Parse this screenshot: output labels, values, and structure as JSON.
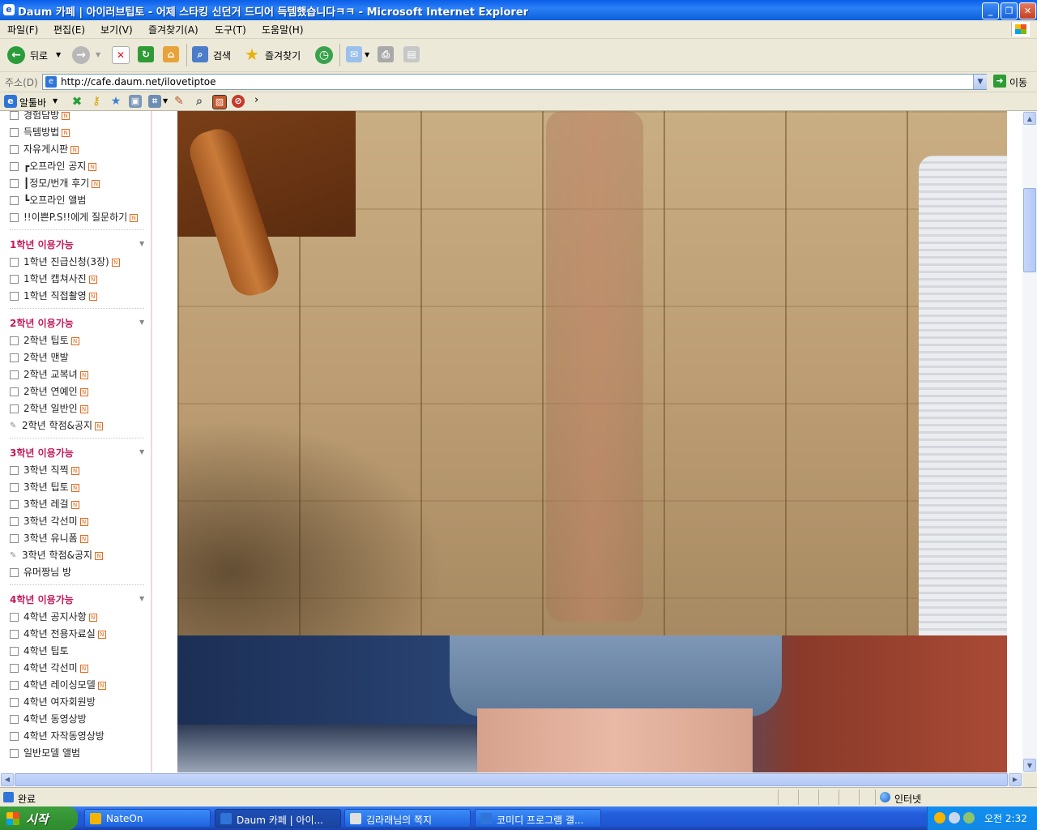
{
  "window": {
    "title": "Daum 카페 | 아이러브팁토 - 어제 스타킹 신던거 드디어 득템했습니다ㅋㅋ - Microsoft Internet Explorer"
  },
  "menu": [
    "파일(F)",
    "편집(E)",
    "보기(V)",
    "즐겨찾기(A)",
    "도구(T)",
    "도움말(H)"
  ],
  "toolbar": {
    "back_label": "뒤로",
    "search_label": "검색",
    "favorites_label": "즐겨찾기"
  },
  "address": {
    "label": "주소(D)",
    "url": "http://cafe.daum.net/ilovetiptoe",
    "go_label": "이동"
  },
  "linksbar": {
    "altoolbar_label": "알툴바"
  },
  "sidebar": {
    "top_items": [
      {
        "label": "경험담방",
        "new": true,
        "icon": "box"
      },
      {
        "label": "득템방법",
        "new": true,
        "icon": "box"
      },
      {
        "label": "자유게시판",
        "new": true,
        "icon": "box"
      },
      {
        "label": "┏오프라인 공지",
        "new": true,
        "icon": "box"
      },
      {
        "label": "┃정모/번개 후기",
        "new": true,
        "icon": "box"
      },
      {
        "label": "┗오프라인 앨범",
        "new": false,
        "icon": "box"
      },
      {
        "label": "!!이쁜P.S!!에게 질문하기",
        "new": true,
        "icon": "box"
      }
    ],
    "sections": [
      {
        "title": "1학년 이용가능",
        "items": [
          {
            "label": "1학년 진급신청(3장)",
            "new": true,
            "icon": "box"
          },
          {
            "label": "1학년 캡쳐사진",
            "new": true,
            "icon": "box"
          },
          {
            "label": "1학년 직접촬영",
            "new": true,
            "icon": "box"
          }
        ]
      },
      {
        "title": "2학년 이용가능",
        "items": [
          {
            "label": "2학년 팁토",
            "new": true,
            "icon": "box"
          },
          {
            "label": "2학년 맨발",
            "new": false,
            "icon": "box"
          },
          {
            "label": "2학년 교복녀",
            "new": true,
            "icon": "box"
          },
          {
            "label": "2학년 연예인",
            "new": true,
            "icon": "box"
          },
          {
            "label": "2학년 일반인",
            "new": true,
            "icon": "box"
          },
          {
            "label": "2학년 학점&공지",
            "new": true,
            "icon": "pen"
          }
        ]
      },
      {
        "title": "3학년 이용가능",
        "items": [
          {
            "label": "3학년 직찍",
            "new": true,
            "icon": "box"
          },
          {
            "label": "3학년 팁토",
            "new": true,
            "icon": "box"
          },
          {
            "label": "3학년 레걸",
            "new": true,
            "icon": "box"
          },
          {
            "label": "3학년 각선미",
            "new": true,
            "icon": "box"
          },
          {
            "label": "3학년 유니폼",
            "new": true,
            "icon": "box"
          },
          {
            "label": "3학년 학점&공지",
            "new": true,
            "icon": "pen"
          },
          {
            "label": "유머짱님 방",
            "new": false,
            "icon": "box"
          }
        ]
      },
      {
        "title": "4학년 이용가능",
        "items": [
          {
            "label": "4학년 공지사항",
            "new": true,
            "icon": "box"
          },
          {
            "label": "4학년 전용자료실",
            "new": true,
            "icon": "box"
          },
          {
            "label": "4학년 팁토",
            "new": false,
            "icon": "box"
          },
          {
            "label": "4학년 각선미",
            "new": true,
            "icon": "box"
          },
          {
            "label": "4학년 레이싱모델",
            "new": true,
            "icon": "box"
          },
          {
            "label": "4학년 여자회원방",
            "new": false,
            "icon": "box"
          },
          {
            "label": "4학년 동영상방",
            "new": false,
            "icon": "box"
          },
          {
            "label": "4학년 자작동영상방",
            "new": false,
            "icon": "box"
          },
          {
            "label": "일반모델 앨범",
            "new": false,
            "icon": "box"
          }
        ]
      }
    ]
  },
  "status": {
    "text": "완료",
    "zone": "인터넷"
  },
  "taskbar": {
    "start_label": "시작",
    "tasks": [
      {
        "label": "NateOn",
        "active": false,
        "color": "#f5b400"
      },
      {
        "label": "Daum 카페 | 아이...",
        "active": true,
        "color": "#2f74d8"
      },
      {
        "label": "김라래님의 쪽지",
        "active": false,
        "color": "#e0e0e0"
      },
      {
        "label": "코미디 프로그램 갤...",
        "active": false,
        "color": "#2f74d8"
      }
    ],
    "clock": "오전 2:32"
  },
  "colors": {
    "section_title": "#c2185b",
    "new_badge": "#e36b1d",
    "xp_blue": "#245edb",
    "start_green": "#2e8a2e"
  }
}
